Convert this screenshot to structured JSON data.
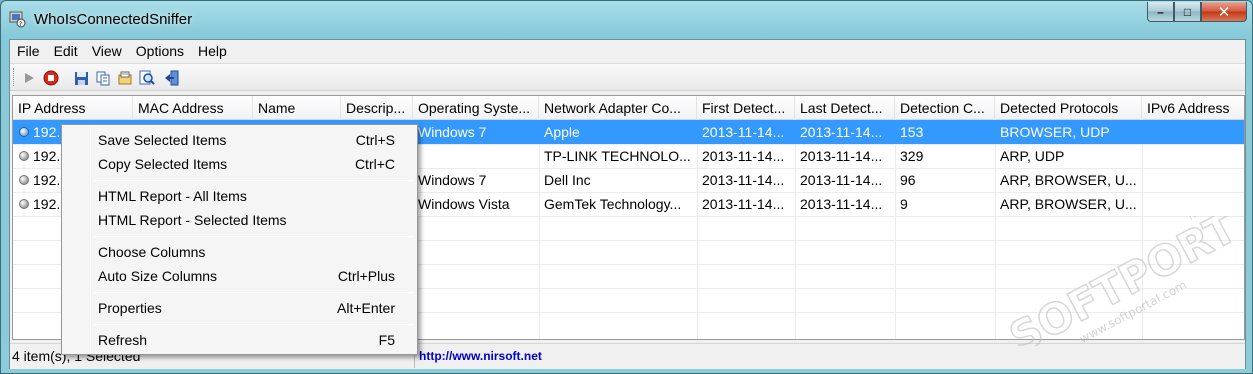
{
  "window": {
    "title": "WhoIsConnectedSniffer"
  },
  "caption_buttons": {
    "minimize": "–",
    "maximize": "□",
    "close": "✕"
  },
  "menu": [
    "File",
    "Edit",
    "View",
    "Options",
    "Help"
  ],
  "toolbar": {
    "icons": [
      "play-icon",
      "stop-icon",
      "save-icon",
      "copy-icon",
      "properties-icon",
      "find-icon",
      "exit-icon"
    ]
  },
  "table": {
    "columns": [
      "IP Address",
      "MAC Address",
      "Name",
      "Descrip...",
      "Operating Syste...",
      "Network Adapter Co...",
      "First Detect...",
      "Last Detect...",
      "Detection C...",
      "Detected Protocols",
      "IPv6 Address"
    ],
    "rows": [
      {
        "ip": "192.",
        "os": "Windows 7",
        "adapter": "Apple",
        "first": "2013-11-14...",
        "last": "2013-11-14...",
        "count": "153",
        "protocols": "BROWSER, UDP",
        "selected": true
      },
      {
        "ip": "192.",
        "os": "",
        "adapter": "TP-LINK TECHNOLO...",
        "first": "2013-11-14...",
        "last": "2013-11-14...",
        "count": "329",
        "protocols": "ARP, UDP",
        "selected": false
      },
      {
        "ip": "192.",
        "os": "Windows 7",
        "adapter": "Dell Inc",
        "first": "2013-11-14...",
        "last": "2013-11-14...",
        "count": "96",
        "protocols": "ARP, BROWSER, U...",
        "selected": false
      },
      {
        "ip": "192.",
        "os": "Windows Vista",
        "adapter": "GemTek Technology...",
        "first": "2013-11-14...",
        "last": "2013-11-14...",
        "count": "9",
        "protocols": "ARP, BROWSER, U...",
        "selected": false
      }
    ]
  },
  "status": {
    "count": "4 item(s), 1 Selected",
    "link": "http://www.nirsoft.net"
  },
  "context_menu": {
    "items": [
      {
        "label": "Save Selected Items",
        "shortcut": "Ctrl+S"
      },
      {
        "label": "Copy Selected Items",
        "shortcut": "Ctrl+C"
      },
      {
        "label": "HTML Report - All Items",
        "shortcut": ""
      },
      {
        "label": "HTML Report - Selected Items",
        "shortcut": ""
      },
      {
        "label": "Choose Columns",
        "shortcut": ""
      },
      {
        "label": "Auto Size Columns",
        "shortcut": "Ctrl+Plus"
      },
      {
        "label": "Properties",
        "shortcut": "Alt+Enter"
      },
      {
        "label": "Refresh",
        "shortcut": "F5"
      }
    ]
  },
  "watermark": {
    "brand": "SOFTPORTAL",
    "url": "www.softportal.com",
    "tm": "TM"
  },
  "colors": {
    "selection": "#3399ff",
    "link": "#0000cc"
  }
}
